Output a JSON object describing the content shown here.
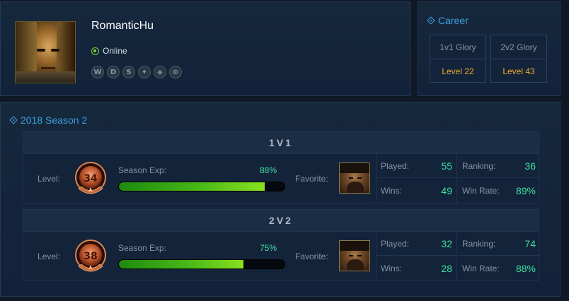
{
  "profile": {
    "username": "RomanticHu",
    "status": "Online",
    "game_icons": [
      {
        "name": "warcraft-icon",
        "glyph": "W"
      },
      {
        "name": "diablo-icon",
        "glyph": "D"
      },
      {
        "name": "starcraft-icon",
        "glyph": "S"
      },
      {
        "name": "heroes-icon",
        "glyph": "✦"
      },
      {
        "name": "hearthstone-icon",
        "glyph": "◈"
      },
      {
        "name": "overwatch-icon",
        "glyph": "⊙"
      }
    ],
    "status_color": "#7bd12e"
  },
  "career": {
    "title": "Career",
    "glory": [
      {
        "label": "1v1 Glory",
        "level": "Level 22"
      },
      {
        "label": "2v2 Glory",
        "level": "Level 43"
      }
    ]
  },
  "season": {
    "title": "2018 Season 2",
    "modes": [
      {
        "header": "1V1",
        "level_label": "Level:",
        "level": "34",
        "exp_label": "Season Exp:",
        "exp_pct_text": "88%",
        "exp_fraction": 0.88,
        "favorite_label": "Favorite:",
        "stats": {
          "played_label": "Played:",
          "played": "55",
          "ranking_label": "Ranking:",
          "ranking": "36",
          "wins_label": "Wins:",
          "wins": "49",
          "winrate_label": "Win Rate:",
          "winrate": "89%"
        }
      },
      {
        "header": "2V2",
        "level_label": "Level:",
        "level": "38",
        "exp_label": "Season Exp:",
        "exp_pct_text": "75%",
        "exp_fraction": 0.75,
        "favorite_label": "Favorite:",
        "stats": {
          "played_label": "Played:",
          "played": "32",
          "ranking_label": "Ranking:",
          "ranking": "74",
          "wins_label": "Wins:",
          "wins": "28",
          "winrate_label": "Win Rate:",
          "winrate": "88%"
        }
      }
    ]
  },
  "colors": {
    "accent": "#3aa0e0",
    "stat_value": "#3ee0a0",
    "glory_level": "#f0a830"
  }
}
